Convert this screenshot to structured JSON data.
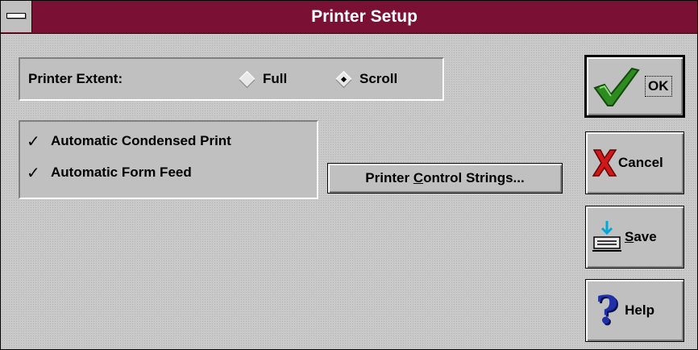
{
  "window": {
    "title": "Printer Setup"
  },
  "extent": {
    "label": "Printer Extent:",
    "options": [
      {
        "label": "Full",
        "selected": false
      },
      {
        "label": "Scroll",
        "selected": true
      }
    ]
  },
  "options": {
    "condensed": {
      "label": "Automatic Condensed Print",
      "checked": true
    },
    "formfeed": {
      "label": "Automatic Form Feed",
      "checked": true
    }
  },
  "control_strings": {
    "label_pre": "Printer ",
    "label_u": "C",
    "label_post": "ontrol Strings..."
  },
  "buttons": {
    "ok": {
      "label": "OK",
      "icon": "checkmark-icon"
    },
    "cancel": {
      "label": "Cancel",
      "icon": "x-icon"
    },
    "save": {
      "label_u": "S",
      "label_post": "ave",
      "icon": "save-icon"
    },
    "help": {
      "label": "Help",
      "icon": "question-icon"
    }
  },
  "colors": {
    "title_bar": "#7b1035",
    "ok_green": "#2e8b1f",
    "cancel_red": "#d01818",
    "help_blue": "#2030a8"
  }
}
